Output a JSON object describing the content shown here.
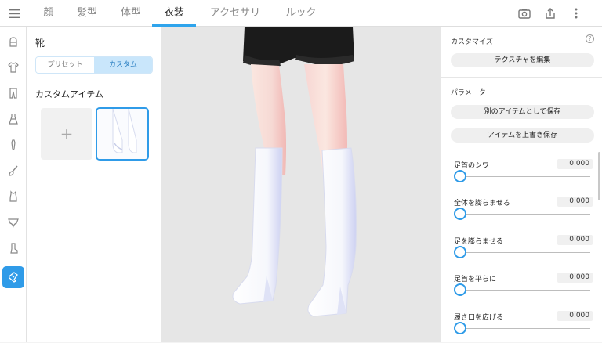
{
  "top_tabs": [
    {
      "label": "顔"
    },
    {
      "label": "髪型"
    },
    {
      "label": "体型"
    },
    {
      "label": "衣装"
    },
    {
      "label": "アクセサリー"
    },
    {
      "label": "ルック"
    }
  ],
  "active_tab": "衣装",
  "top_icons": [
    "camera-icon",
    "share-icon",
    "more-vertical-icon"
  ],
  "rail_icons": [
    "hat-icon",
    "shirt-icon",
    "pants-icon",
    "dress-icon",
    "tie-icon",
    "brush-icon",
    "tank-top-icon",
    "underwear-icon",
    "sock-icon",
    "boot-icon"
  ],
  "left_panel": {
    "title": "靴",
    "segments": [
      "プリセット",
      "カスタム"
    ],
    "active_segment": "カスタム",
    "section_title": "カスタムアイテム",
    "add_symbol": "+"
  },
  "right_panel": {
    "customize_title": "カスタマイズ",
    "help_symbol": "?",
    "edit_texture_label": "テクスチャを編集",
    "params_title": "パラメータ",
    "save_as_new_label": "別のアイテムとして保存",
    "overwrite_label": "アイテムを上書き保存",
    "params": [
      {
        "label": "足首のシワ",
        "value": "0.000"
      },
      {
        "label": "全体を膨らませる",
        "value": "0.000"
      },
      {
        "label": "足を膨らませる",
        "value": "0.000"
      },
      {
        "label": "足首を平らに",
        "value": "0.000"
      },
      {
        "label": "履き口を広げる",
        "value": "0.000"
      }
    ]
  },
  "colors": {
    "accent": "#2f9be8",
    "boot": "#ffffff",
    "shorts": "#1b1b1b",
    "skin": "#f8e4dc"
  }
}
